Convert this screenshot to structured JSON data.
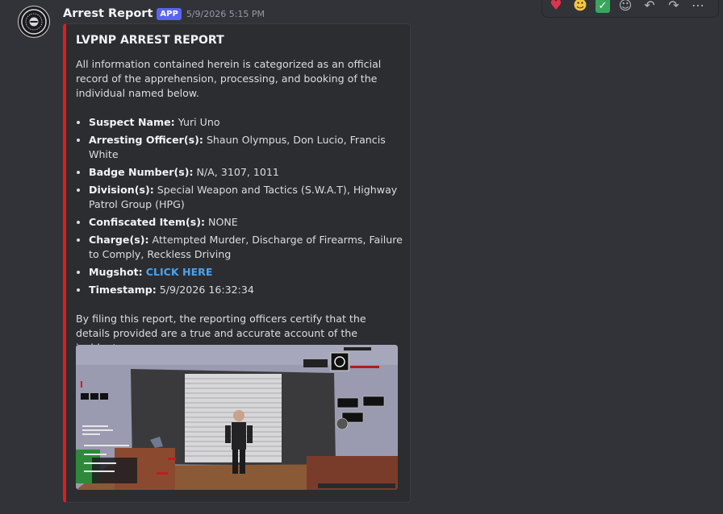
{
  "message": {
    "username": "Arrest Report",
    "app_tag": "APP",
    "timestamp": "5/9/2026 5:15 PM"
  },
  "reactions_bar": {
    "items": [
      "heart-emoji",
      "grinning-emoji",
      "check-mark-emoji",
      "add-reaction-icon",
      "reply-icon",
      "forward-icon",
      "more-options-icon"
    ]
  },
  "embed": {
    "accent_color": "#e41b1b",
    "title": "LVPNP ARREST REPORT",
    "intro": "All information contained herein is categorized as an official record of the apprehension, processing, and booking of the individual named below.",
    "fields": [
      {
        "label": "Suspect Name:",
        "value": "Yuri Uno"
      },
      {
        "label": "Arresting Officer(s):",
        "value": "Shaun Olympus, Don Lucio, Francis White"
      },
      {
        "label": "Badge Number(s):",
        "value": "N/A, 3107, 1011"
      },
      {
        "label": "Division(s):",
        "value": "Special Weapon and Tactics (S.W.A.T), Highway Patrol Group (HPG)"
      },
      {
        "label": "Confiscated Item(s):",
        "value": "NONE"
      },
      {
        "label": "Charge(s):",
        "value": "Attempted Murder, Discharge of Firearms, Failure to Comply, Reckless Driving"
      },
      {
        "label": "Mugshot:",
        "value": "CLICK HERE"
      },
      {
        "label": "Timestamp:",
        "value": "5/9/2026 16:32:34"
      }
    ],
    "closing": "By filing this report, the reporting officers certify that the details provided are a true and accurate account of the incident."
  }
}
